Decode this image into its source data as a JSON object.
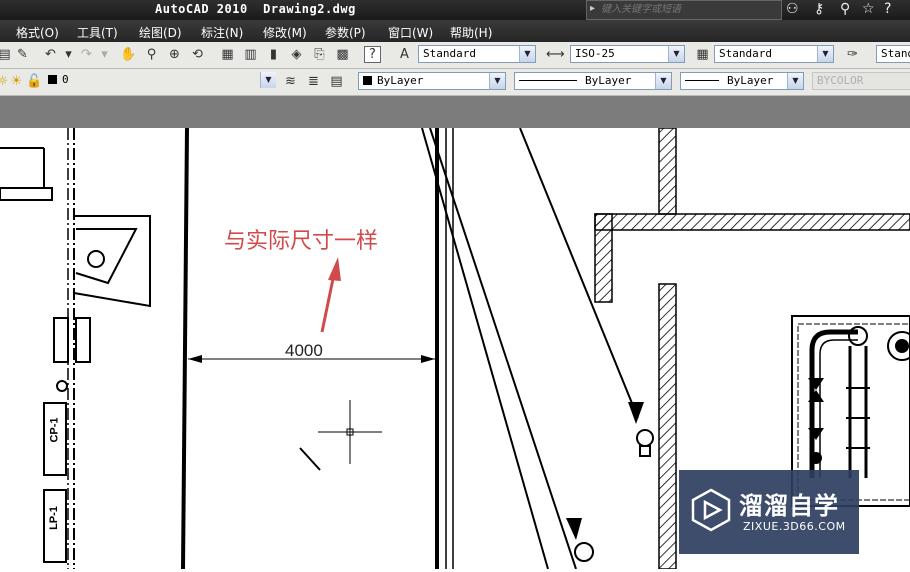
{
  "window": {
    "title": "AutoCAD 2010  Drawing2.dwg"
  },
  "search": {
    "placeholder": "键入关键字或短语"
  },
  "menu": [
    "格式(O)",
    "工具(T)",
    "绘图(D)",
    "标注(N)",
    "修改(M)",
    "参数(P)",
    "窗口(W)",
    "帮助(H)"
  ],
  "toolbar": {
    "text_style": "Standard",
    "dim_style": "ISO-25",
    "table_style": "Standard",
    "multileader_style": "Stand"
  },
  "layers": {
    "current_layer": "0",
    "color": "ByLayer",
    "linetype": "ByLayer",
    "lineweight": "ByLayer",
    "plot_style": "BYCOLOR"
  },
  "drawing": {
    "annotation": "与实际尺寸一样",
    "dimension_value": "4000",
    "tag_top": "CP-1",
    "tag_bottom": "LP-1"
  },
  "watermark": {
    "name": "溜溜自学",
    "url": "ZIXUE.3D66.COM"
  },
  "colors": {
    "annotation": "#d24a4a",
    "watermark_bg": "#2d3e5f"
  }
}
